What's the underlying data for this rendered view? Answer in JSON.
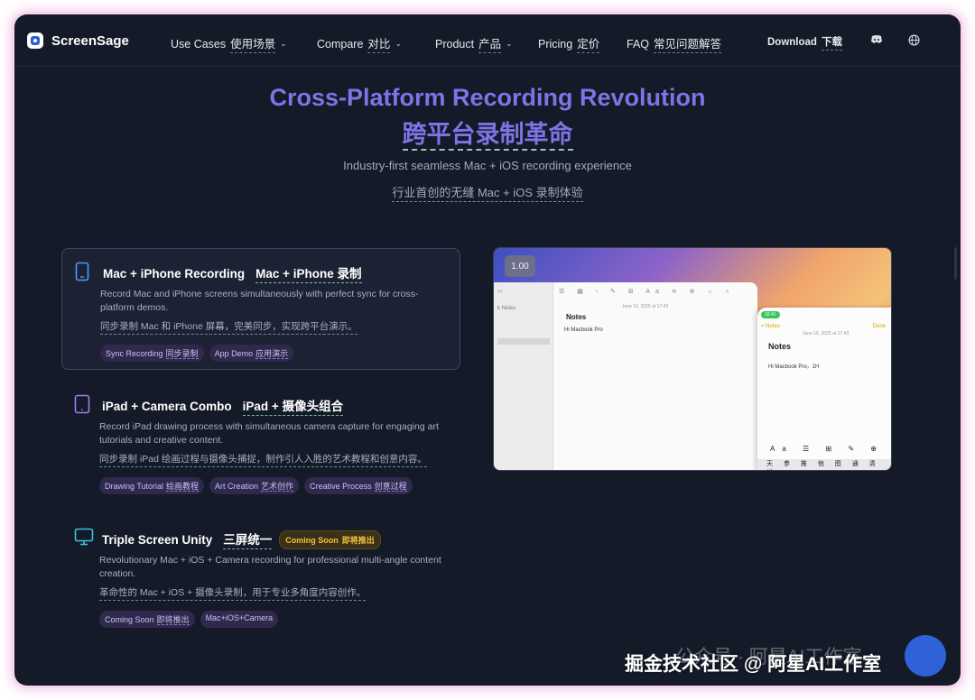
{
  "nav": {
    "brand": "ScreenSage",
    "items": [
      {
        "en": "Use Cases",
        "zh": "使用场景",
        "dropdown": true
      },
      {
        "en": "Compare",
        "zh": "对比",
        "dropdown": true
      },
      {
        "en": "Product",
        "zh": "产品",
        "dropdown": true
      },
      {
        "en": "Pricing",
        "zh": "定价",
        "dropdown": false
      },
      {
        "en": "FAQ",
        "zh": "常见问题解答",
        "dropdown": false
      }
    ],
    "download_en": "Download",
    "download_zh": "下载",
    "icons": [
      "discord-icon",
      "globe-icon"
    ]
  },
  "hero": {
    "title_en": "Cross-Platform Recording Revolution",
    "title_zh": "跨平台录制革命",
    "subtitle_en": "Industry-first seamless Mac + iOS recording experience",
    "subtitle_zh": "行业首创的无缝 Mac + iOS 录制体验"
  },
  "features": [
    {
      "title_en": "Mac + iPhone Recording",
      "title_zh": "Mac + iPhone 录制",
      "desc_en": "Record Mac and iPhone screens simultaneously with perfect sync for cross-platform demos.",
      "desc_zh": "同步录制 Mac 和 iPhone 屏幕，完美同步，实现跨平台演示。",
      "tags": [
        {
          "en": "Sync Recording",
          "zh": "同步录制"
        },
        {
          "en": "App Demo",
          "zh": "应用演示"
        }
      ]
    },
    {
      "title_en": "iPad + Camera Combo",
      "title_zh": "iPad + 摄像头组合",
      "desc_en": "Record iPad drawing process with simultaneous camera capture for engaging art tutorials and creative content.",
      "desc_zh": "同步录制 iPad 绘画过程与摄像头捕捉，制作引人入胜的艺术教程和创意内容。",
      "tags": [
        {
          "en": "Drawing Tutorial",
          "zh": "绘画教程"
        },
        {
          "en": "Art Creation",
          "zh": "艺术创作"
        },
        {
          "en": "Creative Process",
          "zh": "创意过程"
        }
      ]
    },
    {
      "title_en": "Triple Screen Unity",
      "title_zh": "三屏统一",
      "badge_en": "Coming Soon",
      "badge_zh": "即将推出",
      "desc_en": "Revolutionary Mac + iOS + Camera recording for professional multi-angle content creation.",
      "desc_zh": "革命性的 Mac + iOS + 摄像头录制，用于专业多角度内容创作。",
      "tags": [
        {
          "en": "Coming Soon",
          "zh": "即将推出"
        },
        {
          "en": "Mac+iOS+Camera",
          "zh": ""
        }
      ]
    }
  ],
  "preview": {
    "zoom": "1.00",
    "mac_notes_title": "Notes",
    "mac_date": "June 16, 2025 at 17:43",
    "mac_text": "Hi Macbook Pro",
    "iphone_status": "16:41",
    "iphone_back": "< Notes",
    "iphone_done": "Done",
    "iphone_date": "June 16, 2025 at 17:43",
    "iphone_notes_title": "Notes",
    "iphone_text": "Hi Macbook Pro，1H",
    "iphone_toolbar": "Aa ☰ ⊞ ✎ ⊕",
    "iphone_keys": "天 参 推 他 图 通 清 讲"
  },
  "watermark": {
    "line_main": "掘金技术社区 @ 阿星AI工作室",
    "line_faint": "公众号 · 阿星AI工作室"
  },
  "colors": {
    "background": "#141a27",
    "accent": "#7d74e6",
    "tag_bg": "#2f2a4d",
    "coming_soon": "#f3c33c"
  }
}
